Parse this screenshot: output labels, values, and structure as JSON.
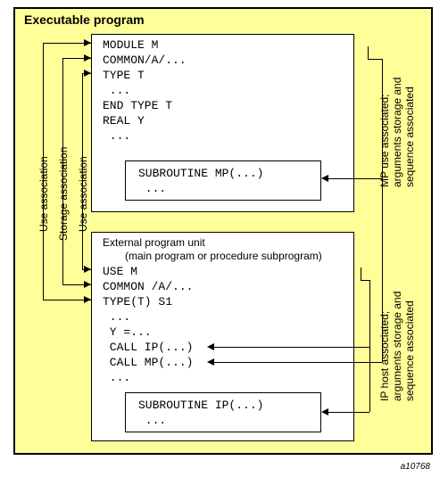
{
  "title": "Executable program",
  "module": {
    "lines": "MODULE M\nCOMMON/A/...\nTYPE T\n ...\nEND TYPE T\nREAL Y\n ..."
  },
  "sub_mp": {
    "lines": "SUBROUTINE MP(...)\n ..."
  },
  "external": {
    "title": "External program unit",
    "subtitle": "(main program or procedure subprogram)",
    "lines": "USE M\nCOMMON /A/...\nTYPE(T) S1\n ...\n Y =...\n CALL IP(...)\n CALL MP(...)\n ..."
  },
  "sub_ip": {
    "lines": "SUBROUTINE IP(...)\n ..."
  },
  "labels": {
    "use_assoc": "Use association",
    "storage_assoc": "Storage association",
    "mp_right": "MP use associated;\narguments storage and\nsequence associated",
    "ip_right": "IP host associated;\narguments storage and\nsequence associated"
  },
  "footer": "a10768"
}
